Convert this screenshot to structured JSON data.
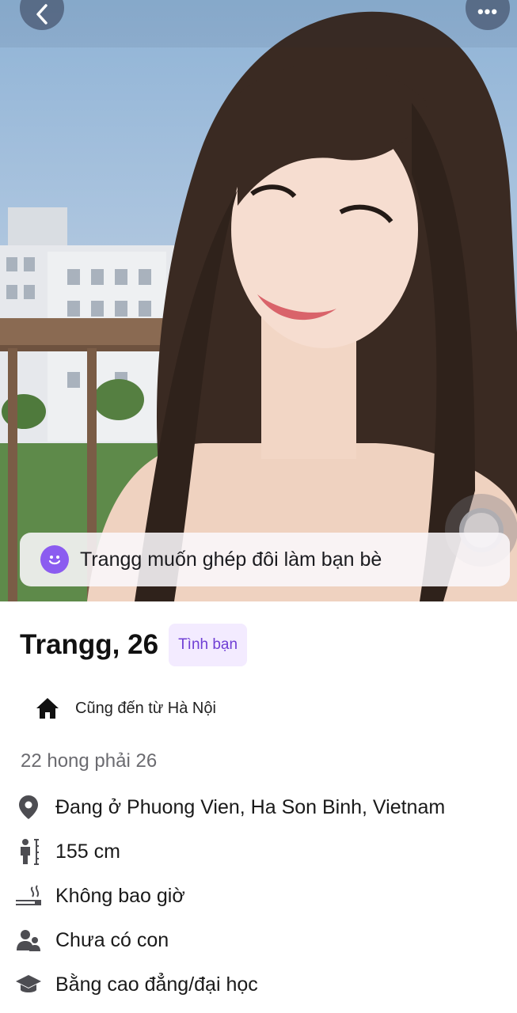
{
  "photo": {
    "back_icon": "chevron-left-icon",
    "more_icon": "more-horizontal-icon",
    "more_label": "•••"
  },
  "match_banner": {
    "icon": "smile-icon",
    "text": "Trangg muốn ghép đôi làm bạn bè",
    "accent": "#8b5cf0"
  },
  "profile": {
    "name_age": "Trangg, 26",
    "tag": "Tình bạn",
    "hometown": "Cũng đến từ Hà Nội",
    "bio": "22 hong phải 26"
  },
  "attributes": [
    {
      "icon": "location-pin-icon",
      "text": "Đang ở Phuong Vien, Ha Son Binh, Vietnam"
    },
    {
      "icon": "height-icon",
      "text": "155 cm"
    },
    {
      "icon": "smoking-icon",
      "text": "Không bao giờ"
    },
    {
      "icon": "children-icon",
      "text": "Chưa có con"
    },
    {
      "icon": "graduation-cap-icon",
      "text": "Bằng cao đẳng/đại học"
    }
  ],
  "colors": {
    "tag_bg": "#f3ebff",
    "tag_text": "#6f3fd4",
    "muted_text": "#6b6b70"
  }
}
